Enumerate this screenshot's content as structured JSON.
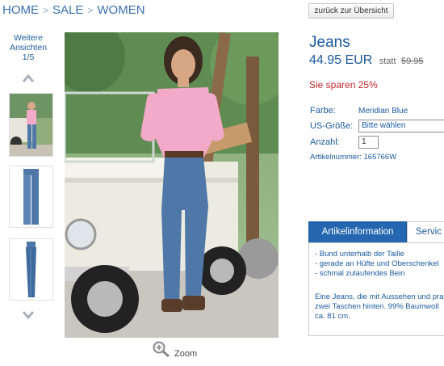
{
  "breadcrumb": {
    "items": [
      "HOME",
      "SALE",
      "WOMEN"
    ],
    "separator": ">"
  },
  "back_button": "zurück zur Übersicht",
  "gallery": {
    "views_label_line1": "Weitere",
    "views_label_line2": "Ansichten",
    "views_counter": "1/5",
    "zoom_label": "Zoom"
  },
  "product": {
    "title": "Jeans",
    "price": "44.95 EUR",
    "statt_label": "statt",
    "old_price": "59.95",
    "savings": "Sie sparen 25%",
    "color_label": "Farbe:",
    "color_value": "Meridian Blue",
    "size_label": "US-Größe:",
    "size_select": "Bitte wählen",
    "qty_label": "Anzahl:",
    "qty_value": "1",
    "article_number": "Artikelnummer: 165766W"
  },
  "tabs": {
    "active": "Artikelinformation",
    "inactive": "Servic"
  },
  "info": {
    "bullets": [
      "- Bund unterhalb der Taille",
      "- gerade an Hüfte und Oberschenkel",
      "- schmal zulaufendes Bein"
    ],
    "desc_lines": [
      "Eine Jeans, die mit Aussehen und pra",
      "zwei Taschen hinten. 99% Baumwoll",
      "ca. 81 cm."
    ]
  },
  "colors": {
    "link_blue": "#1a5a9c",
    "tab_blue": "#2467b0",
    "savings_red": "#c0262d",
    "shirt_pink": "#f3a9c8",
    "denim": "#4f78a8"
  }
}
